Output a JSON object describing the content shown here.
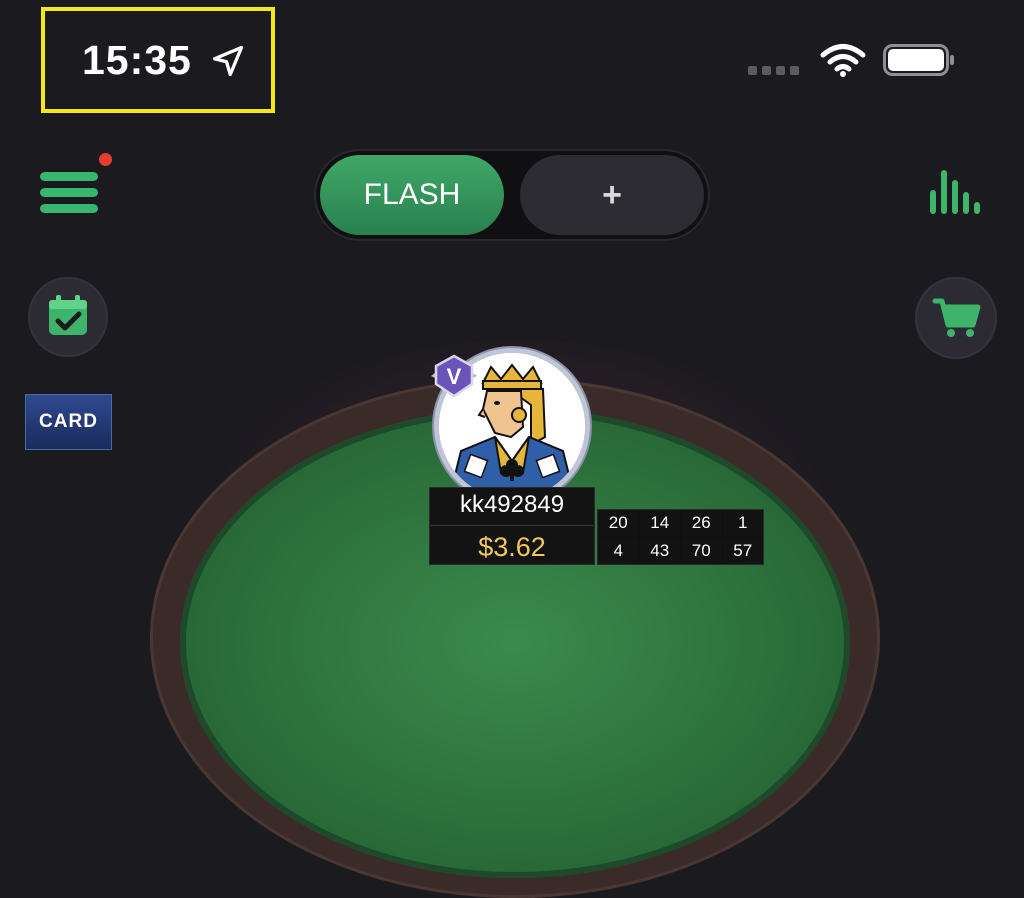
{
  "status_bar": {
    "time": "15:35",
    "location_icon": "location-arrow-icon",
    "wifi_icon": "wifi-icon",
    "battery_icon": "battery-icon",
    "highlight_color": "#f3e81a"
  },
  "left_menu": {
    "menu_icon": "hamburger-menu-icon",
    "notification_dot": true,
    "calendar_icon": "calendar-check-icon",
    "card_label": "CARD"
  },
  "tabs": [
    {
      "label": "FLASH",
      "active": true
    },
    {
      "label": "+",
      "active": false
    }
  ],
  "right_menu": {
    "stats_icon": "bar-stats-icon",
    "cart_icon": "shopping-cart-icon"
  },
  "player": {
    "name": "kk492849",
    "balance": "$3.62",
    "badge": "V",
    "avatar": "king-of-clubs-avatar",
    "stats": [
      "20",
      "14",
      "26",
      "1",
      "4",
      "43",
      "70",
      "57"
    ]
  },
  "colors": {
    "accent": "#38b56e",
    "background": "#1b1a1f",
    "balance": "#f2c85a"
  }
}
